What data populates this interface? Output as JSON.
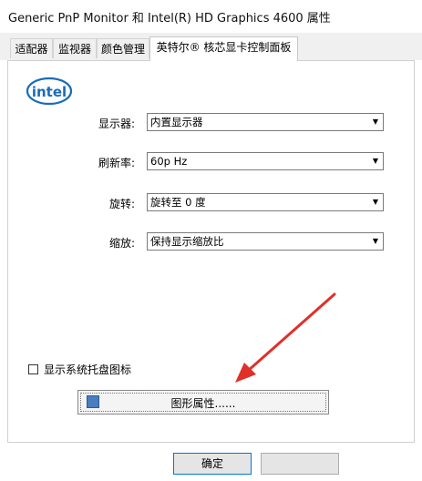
{
  "window": {
    "title": "Generic PnP Monitor 和 Intel(R) HD Graphics 4600 属性"
  },
  "tabs": [
    {
      "label": "适配器"
    },
    {
      "label": "监视器"
    },
    {
      "label": "颜色管理"
    },
    {
      "label": "英特尔® 核芯显卡控制面板"
    }
  ],
  "logo": {
    "text": "intel"
  },
  "fields": {
    "display": {
      "label": "显示器:",
      "value": "内置显示器"
    },
    "refresh": {
      "label": "刷新率:",
      "value": "60p Hz"
    },
    "rotation": {
      "label": "旋转:",
      "value": "旋转至 0 度"
    },
    "scaling": {
      "label": "缩放:",
      "value": "保持显示缩放比"
    }
  },
  "tray_checkbox": {
    "label": "显示系统托盘图标",
    "checked": false
  },
  "graphics_button": {
    "label": "图形属性......"
  },
  "footer": {
    "ok_label": "确定"
  },
  "colors": {
    "intel_blue": "#1a6cb7",
    "annotation_red": "#e0302a",
    "focus_blue": "#0078d7"
  },
  "icons": {
    "dropdown": "chevron-down-icon",
    "graphics": "graphics-properties-icon"
  }
}
